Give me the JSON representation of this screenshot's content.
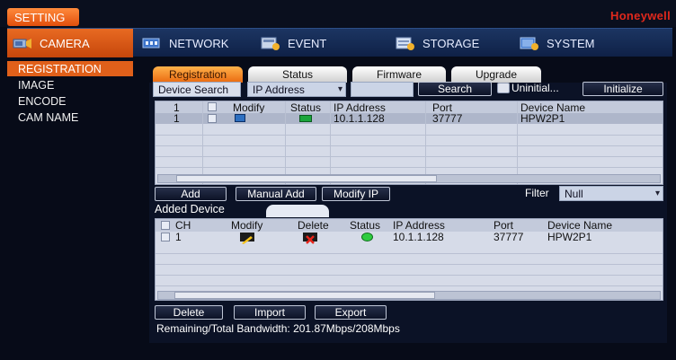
{
  "top": {
    "setting_label": "SETTING",
    "brand": "Honeywell"
  },
  "tabs": {
    "camera": "CAMERA",
    "network": "NETWORK",
    "event": "EVENT",
    "storage": "STORAGE",
    "system": "SYSTEM"
  },
  "sidebar": {
    "items": [
      "REGISTRATION",
      "IMAGE",
      "ENCODE",
      "CAM NAME"
    ]
  },
  "subtabs": [
    "Registration",
    "Status",
    "Firmware",
    "Upgrade"
  ],
  "search": {
    "label": "Device Search",
    "mode_value": "IP Address",
    "button": "Search",
    "uninitial_label": "Uninitial...",
    "initialize_button": "Initialize"
  },
  "search_table": {
    "columns": [
      "Modify",
      "Status",
      "IP Address",
      "Port",
      "Device Name"
    ],
    "header_num": "1",
    "rows": [
      {
        "num": "1",
        "ip": "10.1.1.128",
        "port": "37777",
        "name": "HPW2P1"
      }
    ]
  },
  "actions": {
    "add": "Add",
    "manual_add": "Manual Add",
    "modify_ip": "Modify IP",
    "filter_label": "Filter",
    "filter_value": "Null"
  },
  "added": {
    "title": "Added Device",
    "columns": [
      "CH",
      "Modify",
      "Delete",
      "Status",
      "IP Address",
      "Port",
      "Device Name"
    ],
    "rows": [
      {
        "ch": "1",
        "ip": "10.1.1.128",
        "port": "37777",
        "name": "HPW2P1"
      }
    ]
  },
  "bottom": {
    "delete": "Delete",
    "import": "Import",
    "export": "Export",
    "bandwidth": "Remaining/Total Bandwidth: 201.87Mbps/208Mbps"
  },
  "colors": {
    "accent": "#e0601a",
    "brand": "#e0281c",
    "tabbar": "#1c3562",
    "status_online": "#2ecc40"
  },
  "icons": {
    "camera": "camera-icon",
    "network": "network-icon",
    "event": "event-icon",
    "storage": "storage-icon",
    "system": "system-icon",
    "modify": "pencil-icon",
    "delete": "x-icon",
    "status_online": "green-dot-icon"
  }
}
